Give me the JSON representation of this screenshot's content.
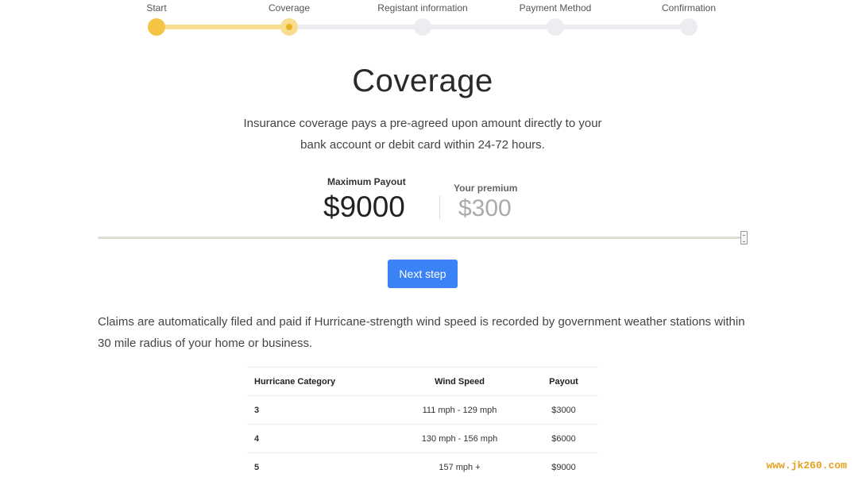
{
  "stepper": {
    "steps": [
      {
        "label": "Start",
        "state": "done"
      },
      {
        "label": "Coverage",
        "state": "active"
      },
      {
        "label": "Registant information",
        "state": "pending"
      },
      {
        "label": "Payment Method",
        "state": "pending"
      },
      {
        "label": "Confirmation",
        "state": "pending"
      }
    ],
    "progress_fraction": 0.25
  },
  "page": {
    "title": "Coverage",
    "subtitle_line1": "Insurance coverage pays a pre-agreed upon amount directly to your",
    "subtitle_line2": "bank account or debit card within 24-72 hours."
  },
  "payout": {
    "max_label": "Maximum Payout",
    "max_value": "$9000",
    "premium_label": "Your premium",
    "premium_value": "$300"
  },
  "slider": {
    "value_fraction": 1.0
  },
  "actions": {
    "next_label": "Next step"
  },
  "claims_text": "Claims are automatically filed and paid if Hurricane-strength wind speed is recorded by government weather stations within 30 mile radius of your home or business.",
  "table": {
    "headers": [
      "Hurricane Category",
      "Wind Speed",
      "Payout"
    ],
    "rows": [
      [
        "3",
        "111 mph - 129 mph",
        "$3000"
      ],
      [
        "4",
        "130 mph - 156 mph",
        "$6000"
      ],
      [
        "5",
        "157 mph +",
        "$9000"
      ]
    ]
  },
  "watermark": "www.jk260.com",
  "colors": {
    "accent": "#f4c542",
    "button": "#3b82f6"
  }
}
